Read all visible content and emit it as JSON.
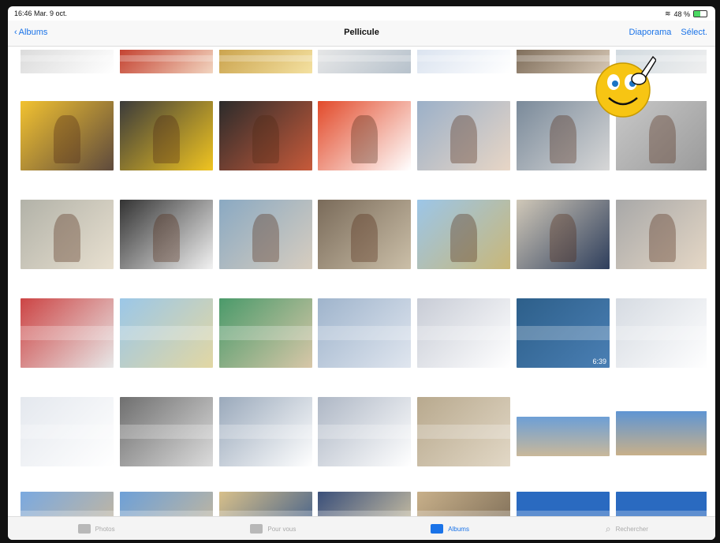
{
  "status_bar": {
    "time_date": "16:46 Mar. 9 oct.",
    "battery": "48 %",
    "battery_level": 0.48
  },
  "nav": {
    "back_label": "Albums",
    "title": "Pellicule",
    "slideshow_label": "Diaporama",
    "select_label": "Sélect."
  },
  "colors": {
    "accent": "#1a73e8",
    "battery": "#4cd964"
  },
  "icons": {
    "back": "chevron-left-icon",
    "photos_tab": "photos-icon",
    "for_you_tab": "for-you-icon",
    "albums_tab": "albums-icon",
    "search_tab": "search-icon",
    "overlay": "smiley-pointing-hand-icon"
  },
  "video_durations": {
    "row4_col6": "6:39"
  },
  "tabs": [
    {
      "label": "Photos"
    },
    {
      "label": "Pour vous"
    },
    {
      "label": "Albums",
      "active": true
    },
    {
      "label": "Rechercher"
    }
  ]
}
